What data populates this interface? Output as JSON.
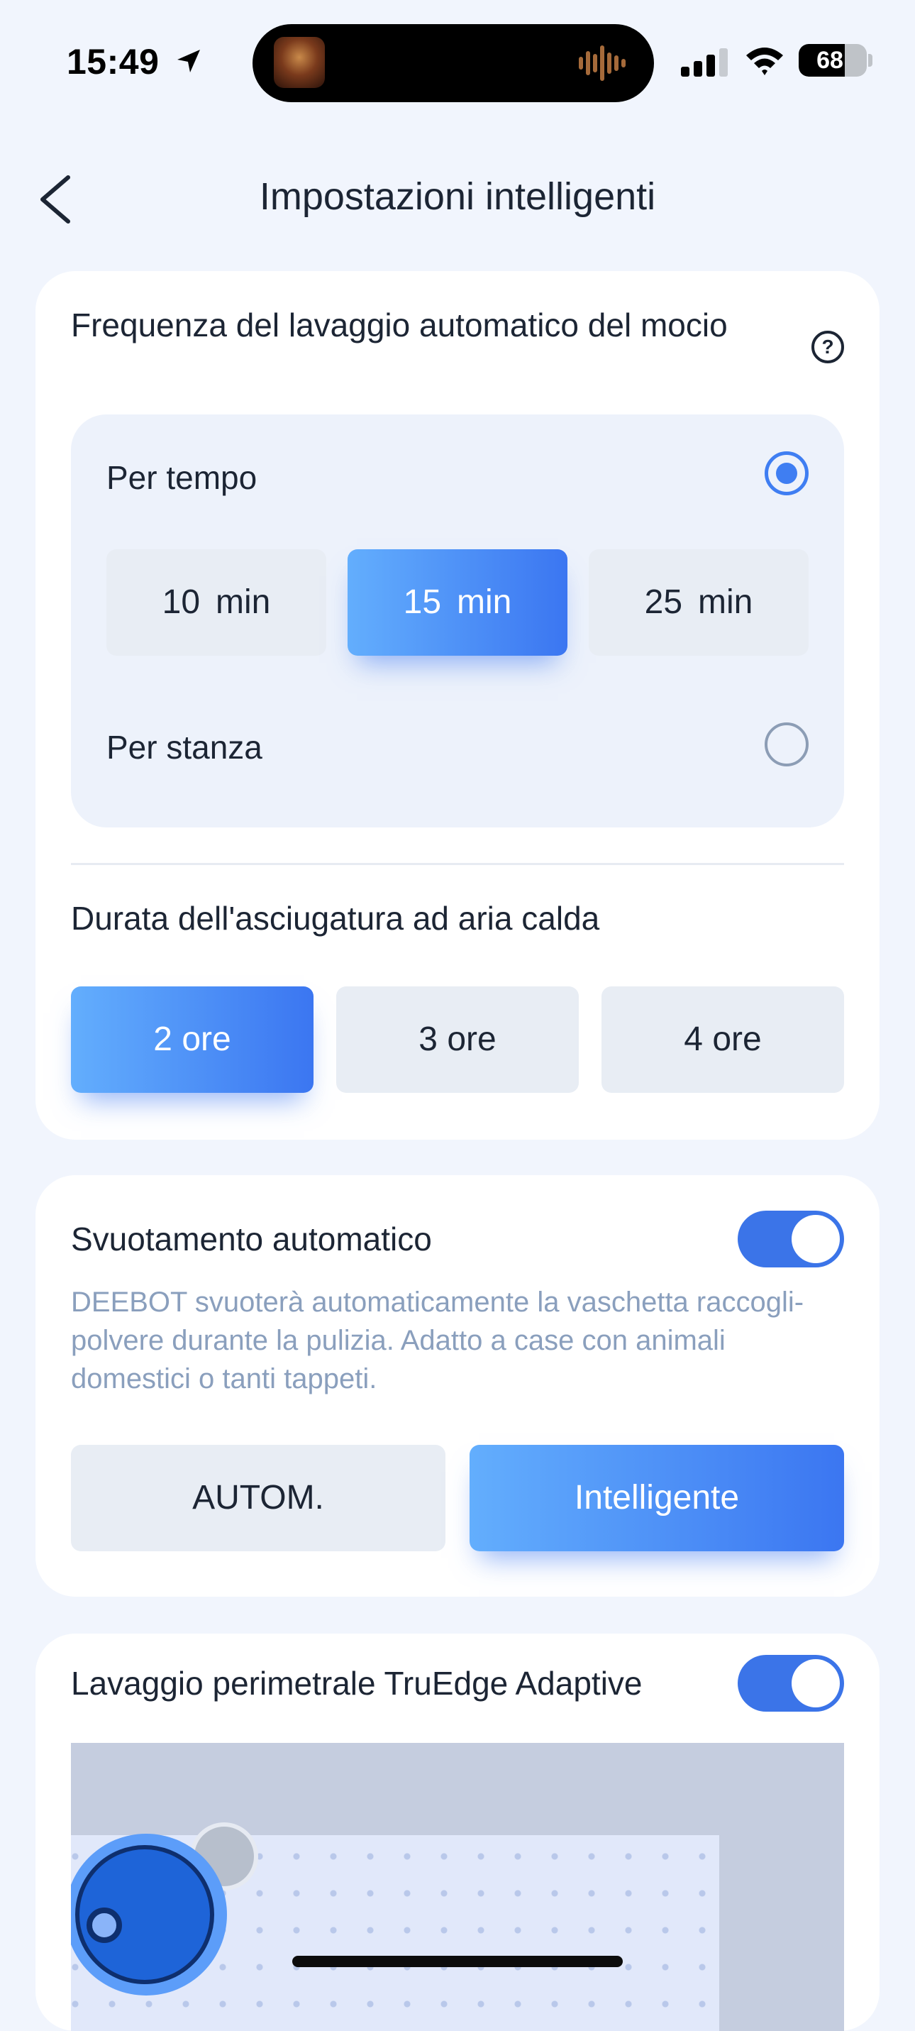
{
  "status_bar": {
    "time": "15:49",
    "battery": "68",
    "battery_level": 0.68
  },
  "nav": {
    "title": "Impostazioni intelligenti",
    "back_icon": "chevron-left-icon"
  },
  "mop_wash": {
    "title": "Frequenza del lavaggio automatico del mocio",
    "help_icon": "?",
    "by_time": {
      "label": "Per tempo",
      "selected": true,
      "options": [
        {
          "value": "10",
          "unit": "min",
          "active": false
        },
        {
          "value": "15",
          "unit": "min",
          "active": true
        },
        {
          "value": "25",
          "unit": "min",
          "active": false
        }
      ]
    },
    "by_room": {
      "label": "Per stanza",
      "selected": false
    }
  },
  "drying": {
    "title": "Durata dell'asciugatura ad aria calda",
    "options": [
      {
        "label": "2 ore",
        "active": true
      },
      {
        "label": "3 ore",
        "active": false
      },
      {
        "label": "4 ore",
        "active": false
      }
    ]
  },
  "auto_empty": {
    "title": "Svuotamento automatico",
    "enabled": true,
    "description": "DEEBOT svuoterà automaticamente la vaschetta raccogli-polvere durante la pulizia. Adatto a case con animali domestici o tanti tappeti.",
    "modes": [
      {
        "label": "AUTOM.",
        "active": false
      },
      {
        "label": "Intelligente",
        "active": true
      }
    ]
  },
  "truedge": {
    "title": "Lavaggio perimetrale TruEdge Adaptive",
    "enabled": true
  },
  "colors": {
    "accent": "#3b76f1",
    "accent_light": "#63aefd",
    "background": "#f1f5fd",
    "card": "#ffffff",
    "muted_text": "#8a9fbd"
  }
}
